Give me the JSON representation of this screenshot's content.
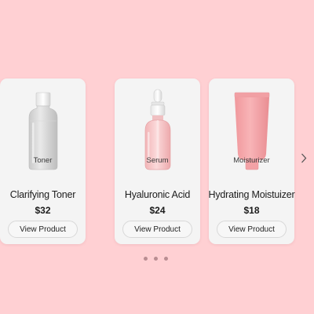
{
  "carousel": {
    "prev_icon": "chevron-left-icon",
    "next_icon": "chevron-right-icon",
    "products": [
      {
        "category": "Serum",
        "name": "Hyaluronic Acid",
        "price": "$24",
        "button": "View Product",
        "image": "serum-dropper-bottle-icon"
      },
      {
        "category": "Moisturizer",
        "name": "Hydrating Moistuizer",
        "price": "$18",
        "button": "View Product",
        "image": "moisturizer-tube-icon"
      },
      {
        "category": "Toner",
        "name": "Clarifying Toner",
        "price": "$32",
        "button": "View Product",
        "image": "toner-bottle-icon"
      }
    ],
    "pagination": {
      "count": 3,
      "active": 0
    }
  },
  "colors": {
    "background": "#ffd0d3",
    "card": "#f4f4f4",
    "dot": "#b98d92"
  }
}
